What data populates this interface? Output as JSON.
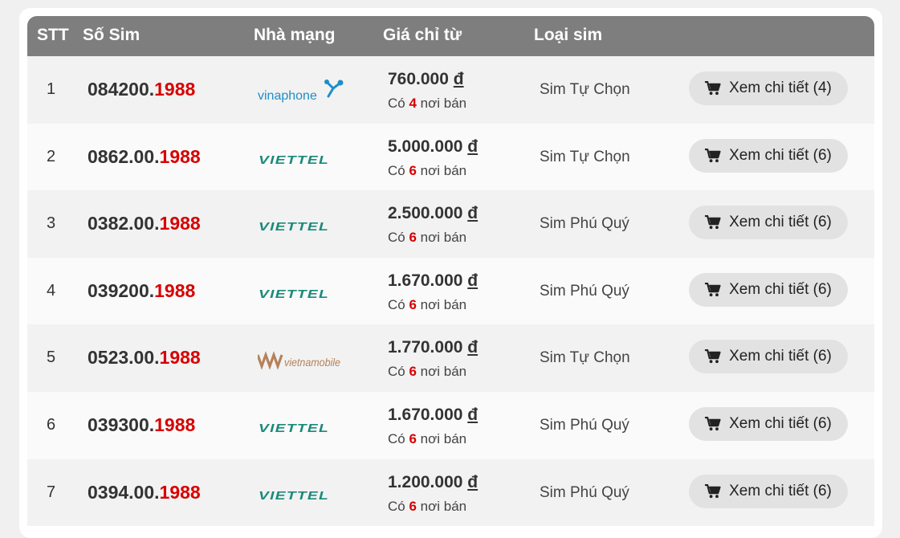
{
  "table": {
    "headers": [
      "STT",
      "Số Sim",
      "Nhà mạng",
      "Giá chỉ từ",
      "Loại sim"
    ],
    "rows": [
      {
        "stt": "1",
        "num_prefix": "084200.",
        "num_tail": "1988",
        "carrier": "vinaphone",
        "price": "760.000",
        "currency": "đ",
        "sellers_pre": "Có",
        "sellers_count": "4",
        "sellers_post": "nơi bán",
        "type": "Sim Tự Chọn",
        "button": "Xem chi tiết (4)"
      },
      {
        "stt": "2",
        "num_prefix": "0862.00.",
        "num_tail": "1988",
        "carrier": "viettel",
        "price": "5.000.000",
        "currency": "đ",
        "sellers_pre": "Có",
        "sellers_count": "6",
        "sellers_post": "nơi bán",
        "type": "Sim Tự Chọn",
        "button": "Xem chi tiết (6)"
      },
      {
        "stt": "3",
        "num_prefix": "0382.00.",
        "num_tail": "1988",
        "carrier": "viettel",
        "price": "2.500.000",
        "currency": "đ",
        "sellers_pre": "Có",
        "sellers_count": "6",
        "sellers_post": "nơi bán",
        "type": "Sim Phú Quý",
        "button": "Xem chi tiết (6)"
      },
      {
        "stt": "4",
        "num_prefix": "039200.",
        "num_tail": "1988",
        "carrier": "viettel",
        "price": "1.670.000",
        "currency": "đ",
        "sellers_pre": "Có",
        "sellers_count": "6",
        "sellers_post": "nơi bán",
        "type": "Sim Phú Quý",
        "button": "Xem chi tiết (6)"
      },
      {
        "stt": "5",
        "num_prefix": "0523.00.",
        "num_tail": "1988",
        "carrier": "vietnamobile",
        "price": "1.770.000",
        "currency": "đ",
        "sellers_pre": "Có",
        "sellers_count": "6",
        "sellers_post": "nơi bán",
        "type": "Sim Tự Chọn",
        "button": "Xem chi tiết (6)"
      },
      {
        "stt": "6",
        "num_prefix": "039300.",
        "num_tail": "1988",
        "carrier": "viettel",
        "price": "1.670.000",
        "currency": "đ",
        "sellers_pre": "Có",
        "sellers_count": "6",
        "sellers_post": "nơi bán",
        "type": "Sim Phú Quý",
        "button": "Xem chi tiết (6)"
      },
      {
        "stt": "7",
        "num_prefix": "0394.00.",
        "num_tail": "1988",
        "carrier": "viettel",
        "price": "1.200.000",
        "currency": "đ",
        "sellers_pre": "Có",
        "sellers_count": "6",
        "sellers_post": "nơi bán",
        "type": "Sim Phú Quý",
        "button": "Xem chi tiết (6)"
      }
    ]
  },
  "logos": {
    "vinaphone": "vinaphone",
    "viettel": "VIETTEL",
    "vietnamobile": "vietnamobile"
  },
  "icons": {
    "cart": "cart-icon"
  },
  "colors": {
    "header_bg": "#7e7e7e",
    "accent_red": "#d80000",
    "vinaphone_blue": "#1f8ec8",
    "viettel_green": "#1b8a7a",
    "vietnamobile_tan": "#b5825a",
    "button_bg": "#e2e2e2"
  }
}
